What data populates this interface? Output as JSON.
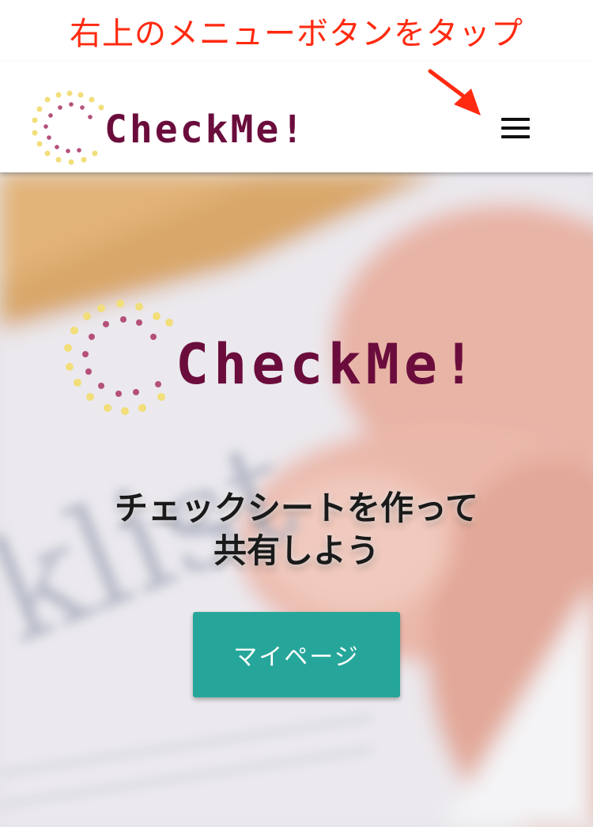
{
  "instruction": {
    "text": "右上のメニューボタンをタップ"
  },
  "header": {
    "logo_text": "CheckMe!",
    "menu_icon": "hamburger-menu-icon"
  },
  "hero": {
    "logo_text": "CheckMe!",
    "title_line1": "チェックシートを作って",
    "title_line2": "共有しよう",
    "mypage_button_label": "マイページ"
  },
  "colors": {
    "instruction": "#ff2a10",
    "brand": "#6b0d3c",
    "button": "#26a69a",
    "logo_dot_yellow": "#f2de7a",
    "logo_dot_pink": "#b4507a"
  }
}
